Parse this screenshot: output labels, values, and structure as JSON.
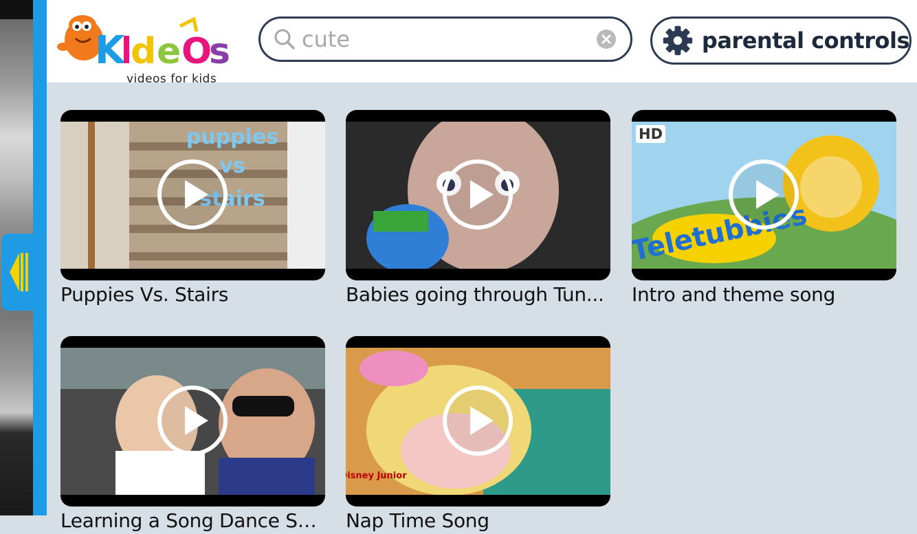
{
  "app": {
    "logo_text": "Kideos",
    "tagline": "videos for kids"
  },
  "search": {
    "query": "cute"
  },
  "parental_controls": {
    "label": "parental controls"
  },
  "videos": [
    {
      "title": "Puppies Vs. Stairs",
      "overlay": "puppies vs stairs",
      "hd": false
    },
    {
      "title": "Babies going through Tun...",
      "hd": false
    },
    {
      "title": "Intro and theme song",
      "overlay": "Teletubbies",
      "hd": true,
      "badge": "HD"
    },
    {
      "title": "Learning a Song Dance Se...",
      "hd": false
    },
    {
      "title": "Nap Time Song",
      "overlay": "Disney Junior",
      "hd": false
    }
  ],
  "colors": {
    "rail": "#1f9be6",
    "header_bg": "#ffffff",
    "content_bg": "#d6dee6",
    "border": "#2c3b52"
  }
}
